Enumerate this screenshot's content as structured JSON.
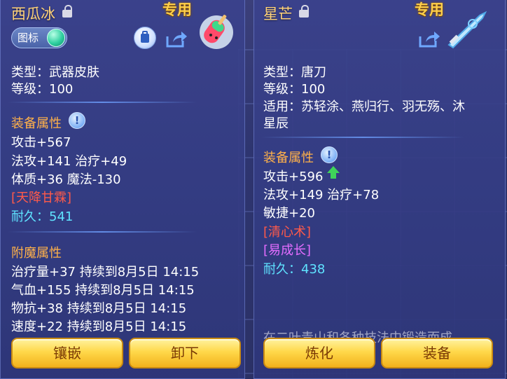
{
  "left_panel": {
    "title": "西瓜冰",
    "exclusive_badge": "专用",
    "toggle_label": "图标",
    "type_line": "类型：武器皮肤",
    "level_line": "等级：100",
    "equip_section": "装备属性",
    "stats": [
      "攻击+567",
      "法攻+141 治疗+49",
      "体质+36 魔法-130"
    ],
    "special_skill": "[天降甘霖]",
    "durability_label": "耐久：",
    "durability_value": "541",
    "enchant_section": "附魔属性",
    "enchants": [
      "治疗量+37 持续到8月5日 14:15",
      "气血+155 持续到8月5日 14:15",
      "物抗+38 持续到8月5日 14:15",
      "速度+22 持续到8月5日 14:15"
    ],
    "buttons": [
      "镶嵌",
      "卸下"
    ]
  },
  "right_panel": {
    "title": "星芒",
    "exclusive_badge": "专用",
    "type_line": "类型：唐刀",
    "level_line": "等级：100",
    "applicable_line1": "适用：苏轻涂、燕归行、羽无殇、沐",
    "applicable_line2": "星辰",
    "equip_section": "装备属性",
    "stats": [
      "攻击+596",
      "法攻+149 治疗+78",
      "敏捷+20"
    ],
    "skill_red": "[清心术]",
    "skill_purple": "[易成长]",
    "durability_label": "耐久：",
    "durability_value": "438",
    "footer_partial": "在二叶青山和各种技法中锻造而成",
    "buttons": [
      "炼化",
      "装备"
    ]
  },
  "colors": {
    "title": "#ffd27a",
    "section": "#ffb14a",
    "skill_red": "#ff5a4a",
    "skill_purple": "#e36dff",
    "durability": "#5fe3ff",
    "button": "#ffd84a"
  },
  "icons": [
    "lock-icon",
    "info-icon",
    "share-icon",
    "bag-icon",
    "up-arrow-icon",
    "popsicle-skin-icon",
    "blade-icon"
  ]
}
